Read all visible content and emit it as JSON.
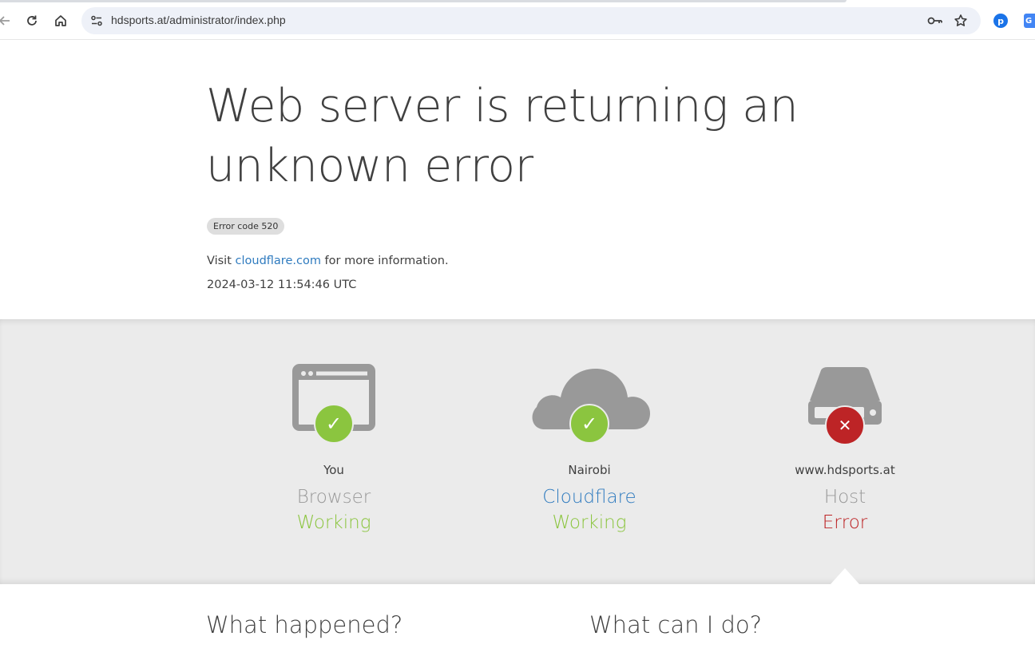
{
  "browser": {
    "url": "hdsports.at/administrator/index.php",
    "icons": [
      "back-arrow-icon",
      "reload-icon",
      "home-icon",
      "site-info-icon",
      "password-key-icon",
      "bookmark-star-icon",
      "extension-icon",
      "translate-icon"
    ]
  },
  "header": {
    "headline": "Web server is returning an unknown error",
    "error_code": "Error code 520",
    "visit_prefix": "Visit ",
    "visit_link": "cloudflare.com",
    "visit_suffix": " for more information.",
    "timestamp": "2024-03-12 11:54:46 UTC"
  },
  "status": {
    "nodes": [
      {
        "location": "You",
        "kind": "Browser",
        "state": "Working",
        "state_type": "working",
        "icon": "browser-window-icon"
      },
      {
        "location": "Nairobi",
        "kind": "Cloudflare",
        "state": "Working",
        "state_type": "working",
        "icon": "cloud-icon"
      },
      {
        "location": "www.hdsports.at",
        "kind": "Host",
        "state": "Error",
        "state_type": "error",
        "icon": "server-icon"
      }
    ]
  },
  "lower": {
    "what_happened": "What happened?",
    "what_can_i_do": "What can I do?"
  },
  "colors": {
    "working": "#8bc53f",
    "error": "#bd2426",
    "link": "#2f7bbf",
    "band": "#ebebeb"
  }
}
